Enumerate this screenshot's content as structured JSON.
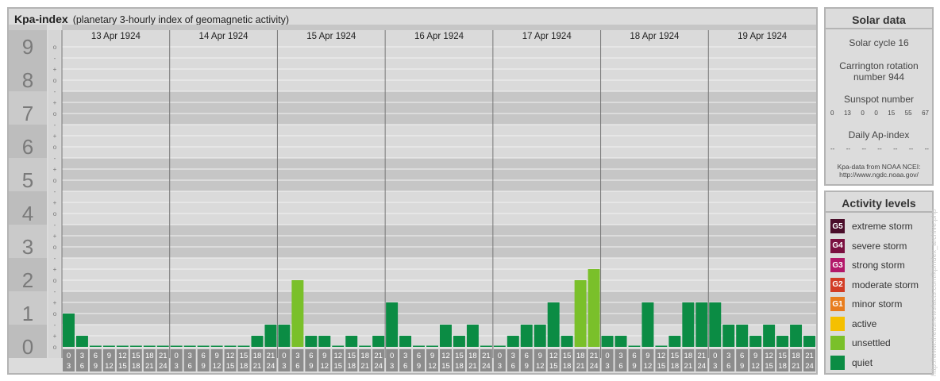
{
  "header": {
    "title": "Kpa-index",
    "subtitle": "(planetary 3-hourly index of geomagnetic activity)"
  },
  "chart_data": {
    "type": "bar",
    "ylim": [
      0,
      9
    ],
    "y_ticks": [
      "0",
      "1",
      "2",
      "3",
      "4",
      "5",
      "6",
      "7",
      "8",
      "9"
    ],
    "minor_tick_labels": [
      "-",
      "o",
      "+"
    ],
    "days": [
      "13 Apr 1924",
      "14 Apr 1924",
      "15 Apr 1924",
      "16 Apr 1924",
      "17 Apr 1924",
      "18 Apr 1924",
      "19 Apr 1924"
    ],
    "interval_start_labels": [
      "0",
      "3",
      "6",
      "9",
      "12",
      "15",
      "18",
      "21"
    ],
    "interval_end_labels": [
      "3",
      "6",
      "9",
      "12",
      "15",
      "18",
      "21",
      "24"
    ],
    "values": [
      [
        1.0,
        0.333,
        0,
        0,
        0,
        0,
        0,
        0
      ],
      [
        0,
        0,
        0,
        0,
        0,
        0,
        0.333,
        0.667
      ],
      [
        0.667,
        2.0,
        0.333,
        0.333,
        0,
        0.333,
        0,
        0.333
      ],
      [
        1.333,
        0.333,
        0,
        0,
        0.667,
        0.333,
        0.667,
        0
      ],
      [
        0,
        0.333,
        0.667,
        0.667,
        1.333,
        0.333,
        2.0,
        2.333
      ],
      [
        0.333,
        0.333,
        0,
        1.333,
        0,
        0.333,
        1.333,
        1.333
      ],
      [
        1.333,
        0.667,
        0.667,
        0.333,
        0.667,
        0.333,
        0.667,
        0.333
      ]
    ],
    "bar_colors": {
      "quiet": "#0b8c44",
      "unsettled": "#7ac02a"
    },
    "grid": true
  },
  "solar": {
    "title": "Solar data",
    "cycle": "Solar cycle 16",
    "carrington_line1": "Carrington rotation",
    "carrington_line2": "number 944",
    "sunspot_title": "Sunspot number",
    "sunspots": [
      "0",
      "13",
      "0",
      "0",
      "15",
      "55",
      "67"
    ],
    "ap_title": "Daily Ap-index",
    "ap": [
      "--",
      "--",
      "--",
      "--",
      "--",
      "--",
      "--"
    ],
    "source_line1": "Kpa-data from NOAA NCEI:",
    "source_line2": "http://www.ngdc.noaa.gov/"
  },
  "activity": {
    "title": "Activity levels",
    "items": [
      {
        "badge": "G5",
        "label": "extreme storm",
        "color": "#4a0d2a"
      },
      {
        "badge": "G4",
        "label": "severe storm",
        "color": "#7a1040"
      },
      {
        "badge": "G3",
        "label": "strong storm",
        "color": "#b3186a"
      },
      {
        "badge": "G2",
        "label": "moderate storm",
        "color": "#d23c25"
      },
      {
        "badge": "G1",
        "label": "minor storm",
        "color": "#e87d1e"
      },
      {
        "badge": "",
        "label": "active",
        "color": "#f5c000"
      },
      {
        "badge": "",
        "label": "unsettled",
        "color": "#7ac02a"
      },
      {
        "badge": "",
        "label": "quiet",
        "color": "#0b8c44"
      }
    ]
  },
  "credit": "http://www.theusnewsfacts.com/kpindex_archive.php"
}
